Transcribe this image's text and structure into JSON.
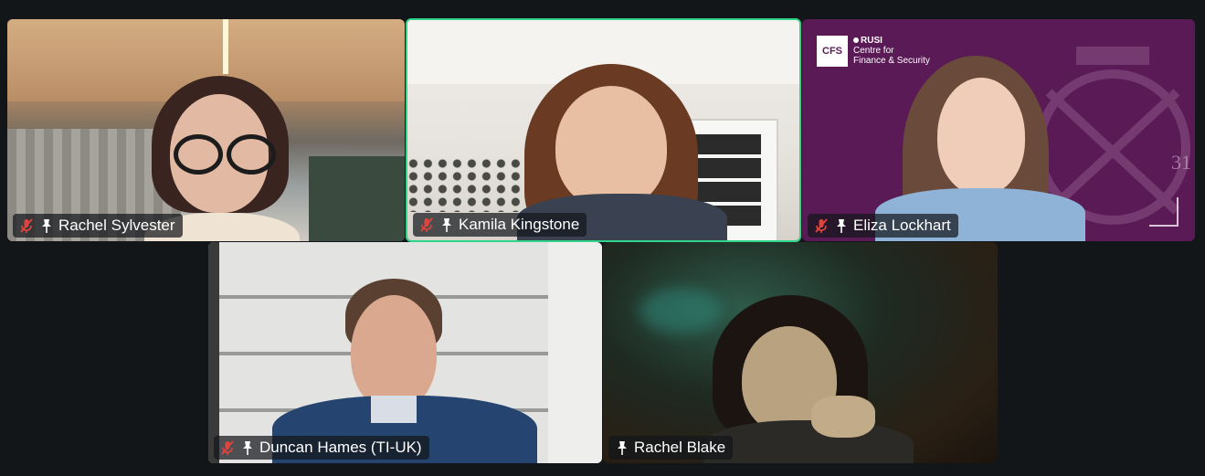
{
  "participants": [
    {
      "name": "Rachel Sylvester",
      "muted": true,
      "pinned_icon": true,
      "active_speaker": false
    },
    {
      "name": "Kamila Kingstone",
      "muted": true,
      "pinned_icon": true,
      "active_speaker": true
    },
    {
      "name": "Eliza Lockhart",
      "muted": true,
      "pinned_icon": true,
      "active_speaker": false
    },
    {
      "name": "Duncan Hames (TI-UK)",
      "muted": true,
      "pinned_icon": true,
      "active_speaker": false
    },
    {
      "name": "Rachel Blake",
      "muted": false,
      "pinned_icon": true,
      "active_speaker": false
    }
  ],
  "backgrounds": {
    "eliza_virtual_bg": {
      "logo_mark": "CFS",
      "logo_org": "RUSI",
      "logo_line1": "Centre for",
      "logo_line2": "Finance & Security",
      "corner_number": "31"
    }
  },
  "colors": {
    "app_background": "#121619",
    "active_speaker_border": "#2fd68a",
    "mute_icon": "#e0443e",
    "nameplate_bg": "rgba(20,22,26,0.72)",
    "rusi_purple": "#5a1a55"
  }
}
